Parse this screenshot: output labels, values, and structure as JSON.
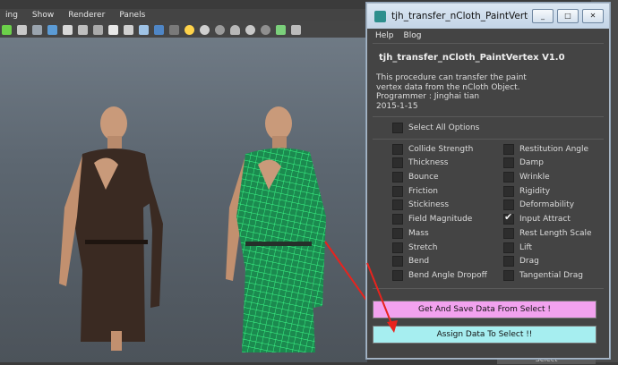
{
  "maya": {
    "menu": [
      "ing",
      "Show",
      "Renderer",
      "Panels"
    ],
    "select_label": "Select"
  },
  "window": {
    "title": "tjh_transfer_nCloth_PaintVertex_t...",
    "min_label": "_",
    "max_label": "□",
    "close_label": "✕",
    "menu": [
      "Help",
      "Blog"
    ],
    "heading": "tjh_transfer_nCloth_PaintVertex V1.0",
    "info": [
      "This procedure can  transfer the paint",
      "vertex  data from the nCloth Object.",
      "Programmer : Jinghai tian",
      "2015-1-15"
    ],
    "select_all_label": "Select All Options",
    "left_options": [
      {
        "label": "Collide Strength",
        "checked": false
      },
      {
        "label": "Thickness",
        "checked": false
      },
      {
        "label": "Bounce",
        "checked": false
      },
      {
        "label": "Friction",
        "checked": false
      },
      {
        "label": "Stickiness",
        "checked": false
      },
      {
        "label": "Field Magnitude",
        "checked": false
      },
      {
        "label": "Mass",
        "checked": false
      },
      {
        "label": "Stretch",
        "checked": false
      },
      {
        "label": "Bend",
        "checked": false
      },
      {
        "label": "Bend Angle Dropoff",
        "checked": false
      }
    ],
    "right_options": [
      {
        "label": "Restitution Angle",
        "checked": false
      },
      {
        "label": "Damp",
        "checked": false
      },
      {
        "label": "Wrinkle",
        "checked": false
      },
      {
        "label": "Rigidity",
        "checked": false
      },
      {
        "label": "Deformability",
        "checked": false
      },
      {
        "label": "Input Attract",
        "checked": true
      },
      {
        "label": "Rest Length Scale",
        "checked": false
      },
      {
        "label": "Lift",
        "checked": false
      },
      {
        "label": "Drag",
        "checked": false
      },
      {
        "label": "Tangential Drag",
        "checked": false
      }
    ],
    "get_button": "Get And Save Data From Select !",
    "assign_button": "Assign Data To Select !!"
  },
  "colors": {
    "get_button": "#f2a2ef",
    "assign_button": "#a6eef0",
    "arrow": "#e8231d",
    "mesh": "#3dff8a"
  }
}
